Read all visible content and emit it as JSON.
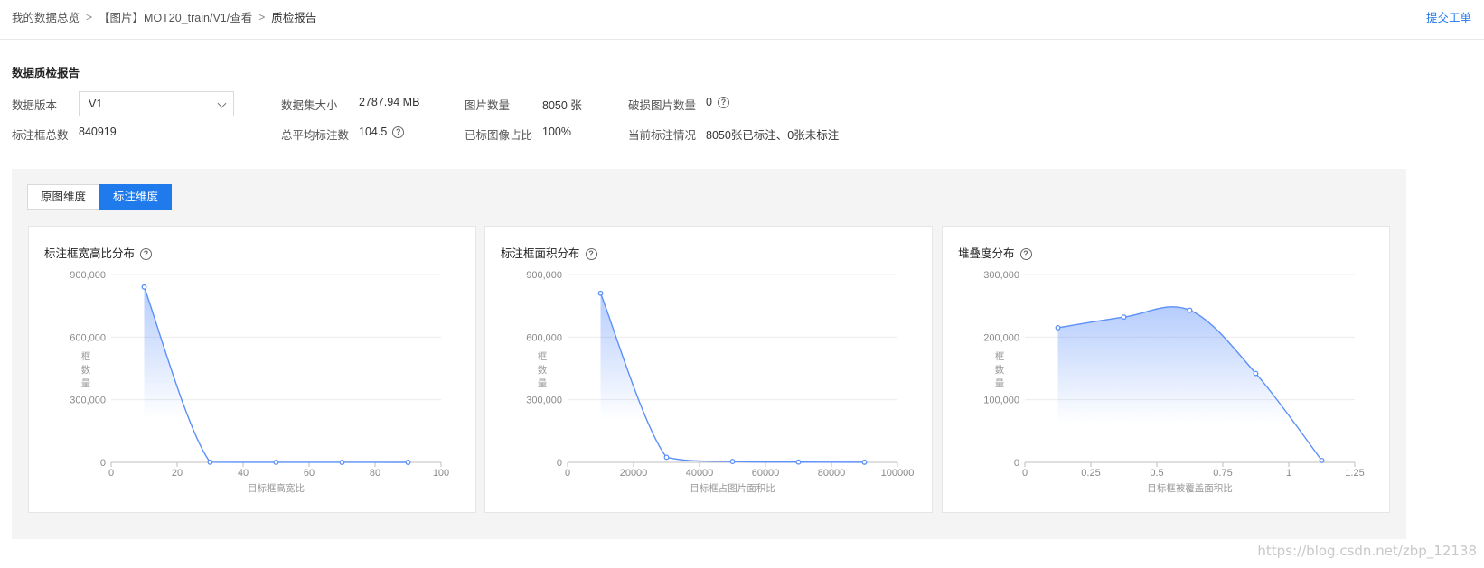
{
  "breadcrumb": {
    "items": [
      "我的数据总览",
      "【图片】MOT20_train/V1/查看",
      "质检报告"
    ]
  },
  "header": {
    "submit_label": "提交工单"
  },
  "section_title": "数据质检报告",
  "info": {
    "version_label": "数据版本",
    "version_value": "V1",
    "dataset_size_label": "数据集大小",
    "dataset_size_value": "2787.94 MB",
    "image_count_label": "图片数量",
    "image_count_value": "8050 张",
    "broken_count_label": "破损图片数量",
    "broken_count_value": "0",
    "box_total_label": "标注框总数",
    "box_total_value": "840919",
    "avg_box_label": "总平均标注数",
    "avg_box_value": "104.5",
    "labeled_ratio_label": "已标图像占比",
    "labeled_ratio_value": "100%",
    "status_label": "当前标注情况",
    "status_value": "8050张已标注、0张未标注"
  },
  "tabs": [
    {
      "label": "原图维度",
      "active": false
    },
    {
      "label": "标注维度",
      "active": true
    }
  ],
  "colors": {
    "accent": "#1f7aec",
    "line": "#5b8ff9",
    "area_top": "#5b8ff9"
  },
  "icons": {
    "help": "question-circle-icon",
    "dropdown": "chevron-down-icon"
  },
  "chart_data": [
    {
      "type": "area",
      "title": "标注框宽高比分布",
      "xlabel": "目标框高宽比",
      "ylabel": "框数量",
      "x": [
        10,
        30,
        50,
        70,
        90
      ],
      "values": [
        840000,
        600,
        150,
        80,
        40
      ],
      "xlim": [
        0,
        100
      ],
      "ylim": [
        0,
        900000
      ],
      "xticks": [
        "0",
        "20",
        "40",
        "60",
        "80",
        "100"
      ],
      "yticks": [
        "0",
        "300,000",
        "600,000",
        "900,000"
      ],
      "grid": true
    },
    {
      "type": "area",
      "title": "标注框面积分布",
      "xlabel": "目标框占图片面积比",
      "ylabel": "框数量",
      "x": [
        10000,
        30000,
        50000,
        70000,
        90000
      ],
      "values": [
        810000,
        24000,
        4000,
        1200,
        500
      ],
      "xlim": [
        0,
        100000
      ],
      "ylim": [
        0,
        900000
      ],
      "xticks": [
        "0",
        "20000",
        "40000",
        "60000",
        "80000",
        "100000"
      ],
      "yticks": [
        "0",
        "300,000",
        "600,000",
        "900,000"
      ],
      "grid": true
    },
    {
      "type": "area",
      "title": "堆叠度分布",
      "xlabel": "目标框被覆盖面积比",
      "ylabel": "框数量",
      "x": [
        0.125,
        0.375,
        0.625,
        0.875,
        1.125
      ],
      "values": [
        215000,
        232000,
        243000,
        142000,
        3000
      ],
      "xlim": [
        0,
        1.25
      ],
      "ylim": [
        0,
        300000
      ],
      "xticks": [
        "0",
        "0.25",
        "0.5",
        "0.75",
        "1",
        "1.25"
      ],
      "yticks": [
        "0",
        "100,000",
        "200,000",
        "300,000"
      ],
      "grid": true
    }
  ],
  "watermark": "https://blog.csdn.net/zbp_12138"
}
